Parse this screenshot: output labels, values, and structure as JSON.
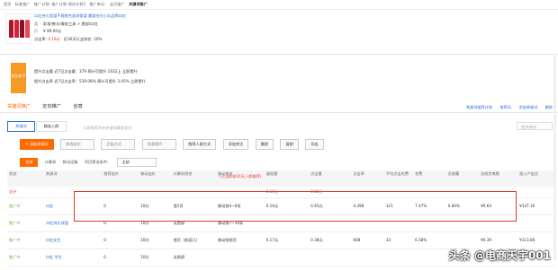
{
  "breadcrumb": [
    "首页",
    "标准推广",
    "推广计划: 推广计划-测试计划5",
    "推广单元:",
    "宝贝推广",
    "关键词推广"
  ],
  "product": {
    "title": "口红持久保湿不易脱色滋润保湿 雾面哑光小众品牌口红",
    "category_label": "类",
    "category": "彩妆/香水/美妆工具 > 唇部/口红",
    "price_label": "价",
    "price": "¥ 99.00元",
    "ctr_label": "点击率:",
    "ctr": "0.18元",
    "rank_text": "近30天行业排名:",
    "rank": "10%"
  },
  "promo": {
    "badge": "优化助手",
    "row1": "提升点击量 近7日点击量：379 预计可提升 1632上 立即提升",
    "row2": "提升点击率 近7日点击率：539.08% 预计可提升 3.45% 立即提升"
  },
  "tabs": [
    "关键词推广",
    "定向推广",
    "创意"
  ],
  "right_links": [
    "关键词推荐计划",
    "推荐词",
    "添加关键词",
    "删除"
  ],
  "subtabs": [
    "关键词",
    "精选人群"
  ],
  "hint": "人群推荐开启关键词精准定向",
  "search_placeholder": "搜关键词",
  "toolbar": {
    "add": "+ 添加关键词",
    "sel1": "修改出价",
    "sel2": "匹配方式",
    "sel3": "批量操作",
    "btn1": "推荐人群方式",
    "btn2": "添加关注",
    "btn3": "删除",
    "btn4": "复制",
    "btn5": "导出"
  },
  "filter": {
    "btn": "全部",
    "label1": "计算机",
    "label2": "移动设备",
    "label3": "项目筛选条件：",
    "sel": "全部"
  },
  "table": {
    "headers": [
      "状态",
      "关键词",
      "推荐出价",
      "移动出价",
      "计算机排名",
      "移动排名",
      "展现量",
      "点击量",
      "点击率",
      "平均点击花费",
      "花费",
      "总收藏",
      "总成交笔数",
      "投入产出比"
    ],
    "orange_hint": "(已当前前30天人群推荐)",
    "summary": [
      "总计",
      "",
      "",
      "",
      "",
      "",
      "0.10元",
      "0.08元",
      "",
      "",
      "",
      "",
      "",
      ""
    ],
    "rows": [
      [
        "推广中",
        "口红",
        "0",
        "10分",
        "首2页",
        "移动前4~6条",
        "0.16元",
        "0.45元",
        "4,398",
        "321",
        "7.47%",
        "0.84%",
        "¥0.64",
        "¥147.30"
      ],
      [
        "推广中",
        "口红持久保湿",
        "0",
        "10分",
        "无首屏",
        "移动前7~10条",
        "",
        "",
        "",
        "",
        "",
        "",
        "",
        ""
      ],
      [
        "推广中",
        "口红女生",
        "0",
        "10分",
        "首页（前面几）",
        "移动前前页",
        "0.17元",
        "0.38元",
        "608",
        "33",
        "6.58%",
        "",
        "¥0.39",
        "¥113.86"
      ],
      [
        "推广中",
        "口红 学生",
        "0",
        "10分",
        "无首屏",
        "",
        "",
        "",
        "",
        "",
        "",
        "",
        "",
        ""
      ]
    ]
  },
  "watermark": "头条 @电商天宇001"
}
